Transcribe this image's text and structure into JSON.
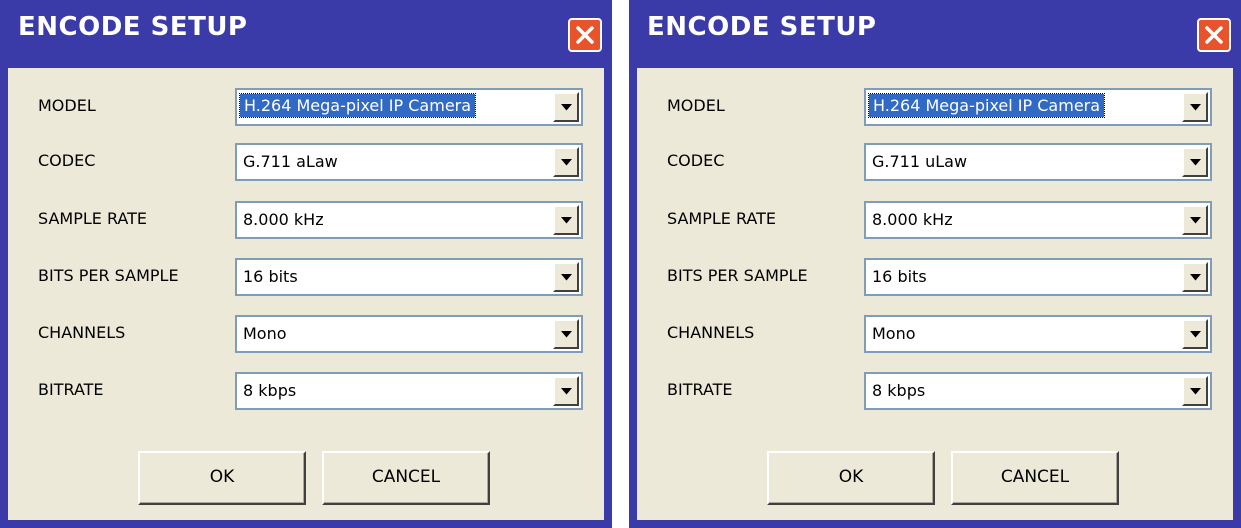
{
  "dialogs": [
    {
      "title": "ENCODE SETUP",
      "fields": {
        "model": {
          "label": "MODEL",
          "value": "H.264 Mega-pixel IP Camera"
        },
        "codec": {
          "label": "CODEC",
          "value": "G.711 aLaw"
        },
        "sample_rate": {
          "label": "SAMPLE RATE",
          "value": "8.000 kHz"
        },
        "bits_per_sample": {
          "label": "BITS PER SAMPLE",
          "value": "16 bits"
        },
        "channels": {
          "label": "CHANNELS",
          "value": "Mono"
        },
        "bitrate": {
          "label": "BITRATE",
          "value": "8 kbps"
        }
      },
      "ok_label": "OK",
      "cancel_label": "CANCEL"
    },
    {
      "title": "ENCODE SETUP",
      "fields": {
        "model": {
          "label": "MODEL",
          "value": "H.264 Mega-pixel IP Camera"
        },
        "codec": {
          "label": "CODEC",
          "value": "G.711 uLaw"
        },
        "sample_rate": {
          "label": "SAMPLE RATE",
          "value": "8.000 kHz"
        },
        "bits_per_sample": {
          "label": "BITS PER SAMPLE",
          "value": "16 bits"
        },
        "channels": {
          "label": "CHANNELS",
          "value": "Mono"
        },
        "bitrate": {
          "label": "BITRATE",
          "value": "8 kbps"
        }
      },
      "ok_label": "OK",
      "cancel_label": "CANCEL"
    }
  ],
  "colors": {
    "title_bar": "#3a3aa8",
    "client_bg": "#ece9d8",
    "close_button": "#e8532c",
    "selection": "#316ac5"
  },
  "icons": {
    "close": "close-icon",
    "dropdown": "chevron-down-icon"
  }
}
